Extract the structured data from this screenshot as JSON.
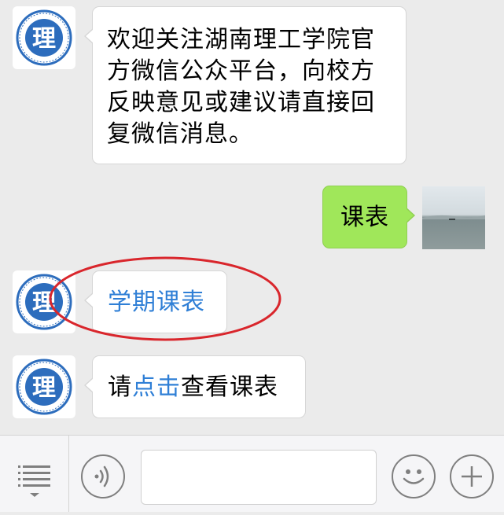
{
  "messages": [
    {
      "direction": "in",
      "text": "欢迎关注湖南理工学院官方微信公众平台，向校方反映意见或建议请直接回复微信消息。"
    },
    {
      "direction": "out",
      "text": "课表"
    },
    {
      "direction": "in",
      "link_text": "学期课表"
    },
    {
      "direction": "in",
      "prefix": "请",
      "link_text": "点击",
      "suffix": "查看课表"
    }
  ],
  "account": {
    "avatar_icon": "school-logo-icon",
    "logo_text": "理",
    "logo_ring_text": "湖南理工学院 Hunan Institute of Science and Technology"
  },
  "user_avatar_icon": "lake-landscape-photo",
  "annotation": {
    "shape": "ellipse",
    "color": "#d9262c"
  },
  "input": {
    "value": "",
    "placeholder": ""
  },
  "toolbar": {
    "menu_icon": "menu-list-icon",
    "voice_icon": "voice-icon",
    "emoji_icon": "emoji-icon",
    "more_icon": "plus-icon"
  },
  "colors": {
    "background": "#ebebeb",
    "incoming_bubble": "#ffffff",
    "outgoing_bubble": "#a0e75a",
    "link": "#2f7fd6",
    "logo_blue": "#2d6dbd"
  }
}
